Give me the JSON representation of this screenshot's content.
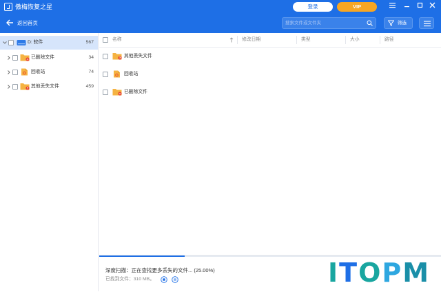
{
  "app": {
    "title": "傲梅恢复之星"
  },
  "header": {
    "login_label": "登录",
    "vip_label": "VIP",
    "back_label": "返回首页",
    "search_placeholder": "搜索文件或文件夹",
    "filter_label": "筛选"
  },
  "sidebar": {
    "drive": {
      "label": "D: 软件",
      "count": "567",
      "icon": "drive-icon"
    },
    "items": [
      {
        "label": "已删除文件",
        "count": "34",
        "icon": "deleted-folder-icon"
      },
      {
        "label": "回收站",
        "count": "74",
        "icon": "recycle-bin-icon"
      },
      {
        "label": "其他丢失文件",
        "count": "459",
        "icon": "lost-folder-icon"
      }
    ]
  },
  "table": {
    "columns": [
      "名称",
      "修改日期",
      "类型",
      "大小",
      "路径"
    ],
    "rows": [
      {
        "name": "其他丢失文件",
        "icon": "lost-folder-icon"
      },
      {
        "name": "回收站",
        "icon": "recycle-bin-icon"
      },
      {
        "name": "已删除文件",
        "icon": "deleted-folder-icon"
      }
    ]
  },
  "scan": {
    "status": "深度扫描：正在查找更多丢失的文件... (25.00%)",
    "progress": 0.25,
    "found": "已找到文件：310 MB。"
  },
  "watermark": {
    "text": "ITOPM"
  },
  "colors": {
    "primary": "#1e6fe6",
    "vip": "#f7a623",
    "folder": "#f5b342",
    "badge": "#e8452c",
    "selected_row": "#d6e5fb"
  }
}
